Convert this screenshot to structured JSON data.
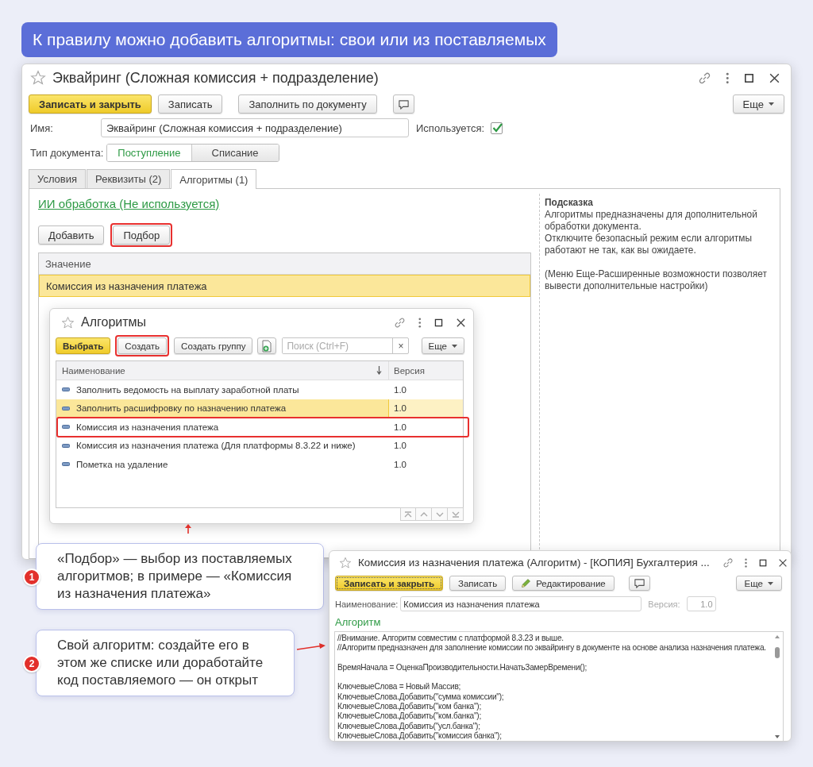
{
  "banner": {
    "text": "К правилу можно добавить алгоритмы: свои или из поставляемых"
  },
  "main_window": {
    "title": "Эквайринг (Сложная комиссия + подразделение)",
    "toolbar": [
      {
        "kind": "default",
        "label": "Записать и закрыть"
      },
      {
        "kind": "plain",
        "label": "Записать"
      },
      {
        "kind": "plain",
        "label": "Заполнить по документу"
      },
      {
        "kind": "comment"
      }
    ],
    "more": "Еще",
    "name_label": "Имя:",
    "name_value": "Эквайринг (Сложная комиссия + подразделение)",
    "used_label": "Используется:",
    "used_checked": true,
    "doc_type_label": "Тип документа:",
    "doc_types": [
      {
        "label": "Поступление",
        "selected": true
      },
      {
        "label": "Списание",
        "selected": false
      }
    ],
    "tabs": [
      {
        "label": "Условия",
        "selected": false
      },
      {
        "label": "Реквизиты (2)",
        "selected": false
      },
      {
        "label": "Алгоритмы (1)",
        "selected": true
      }
    ],
    "ai_link": "ИИ обработка (Не используется)",
    "buttons": [
      {
        "kind": "plain",
        "label": "Добавить",
        "highlighted": false
      },
      {
        "kind": "plain",
        "label": "Подбор",
        "highlighted": true
      }
    ],
    "table": {
      "columns": [
        "Значение"
      ],
      "rows": [
        {
          "value": "Комиссия из назначения платежа",
          "selected": true
        }
      ]
    },
    "hint": {
      "title": "Подсказка",
      "paragraphs": [
        "Алгоритмы предназначены для дополнительной обработки документа.",
        "Отключите безопасный режим если алгоритмы работают не так, как вы ожидаете.",
        "(Меню Еще-Расширенные возможности позволяет вывести дополнительные настройки)"
      ]
    }
  },
  "algorithms_window": {
    "title": "Алгоритмы",
    "toolbar": [
      {
        "kind": "default",
        "label": "Выбрать",
        "highlighted": false
      },
      {
        "kind": "plain",
        "label": "Создать",
        "highlighted": true
      },
      {
        "kind": "plain",
        "label": "Создать группу",
        "highlighted": false
      },
      {
        "kind": "add-file",
        "highlighted": false
      }
    ],
    "search": {
      "placeholder": "Поиск (Ctrl+F)",
      "clear": "×"
    },
    "more": "Еще",
    "columns": [
      "Наименование",
      "Версия"
    ],
    "rows": [
      {
        "name": "Заполнить ведомость на выплату заработной платы",
        "version": "1.0",
        "selected": false,
        "highlighted": false
      },
      {
        "name": "Заполнить расшифровку по назначению платежа",
        "version": "1.0",
        "selected": true,
        "highlighted": false
      },
      {
        "name": "Комиссия из назначения платежа",
        "version": "1.0",
        "selected": false,
        "highlighted": true
      },
      {
        "name": "Комиссия из назначения платежа (Для платформы 8.3.22 и ниже)",
        "version": "1.0",
        "selected": false,
        "highlighted": false
      },
      {
        "name": "Пометка на удаление",
        "version": "1.0",
        "selected": false,
        "highlighted": false
      }
    ]
  },
  "callouts": [
    {
      "number": "1",
      "text": "«Подбор» — выбор из поставляемых алгоритмов; в примере — «Комиссия из назначения платежа»"
    },
    {
      "number": "2",
      "text": "Свой алгоритм: создайте его в этом же списке или доработайте код поставляемого — он открыт"
    }
  ],
  "algorithm_window": {
    "title": "Комиссия из назначения платежа (Алгоритм) - [КОПИЯ] Бухгалтерия ...",
    "toolbar": [
      {
        "kind": "default",
        "label": "Записать и закрыть"
      },
      {
        "kind": "plain",
        "label": "Записать"
      },
      {
        "kind": "edit",
        "label": "Редактирование"
      },
      {
        "kind": "comment"
      }
    ],
    "more": "Еще",
    "name_label": "Наименование:",
    "name_value": "Комиссия из назначения платежа",
    "version_label": "Версия:",
    "version_value": "1.0",
    "version_disabled": true,
    "section": "Алгоритм",
    "code_blocks": [
      [
        "//Внимание. Алгоритм совместим с платформой 8.3.23 и выше.",
        "//Алгоритм предназначен для заполнение комиссии по эквайрингу в документе на основе анализа назначения платежа."
      ],
      [
        "ВремяНачала = ОценкаПроизводительности.НачатьЗамерВремени();"
      ],
      [
        "КлючевыеСлова = Новый Массив;",
        "КлючевыеСлова.Добавить(\"сумма комиссии\");",
        "КлючевыеСлова.Добавить(\"ком банка\");",
        "КлючевыеСлова.Добавить(\"ком.банка\");",
        "КлючевыеСлова.Добавить(\"усл.банка\");",
        "КлючевыеСлова.Добавить(\"комиссия банка\");"
      ]
    ]
  }
}
